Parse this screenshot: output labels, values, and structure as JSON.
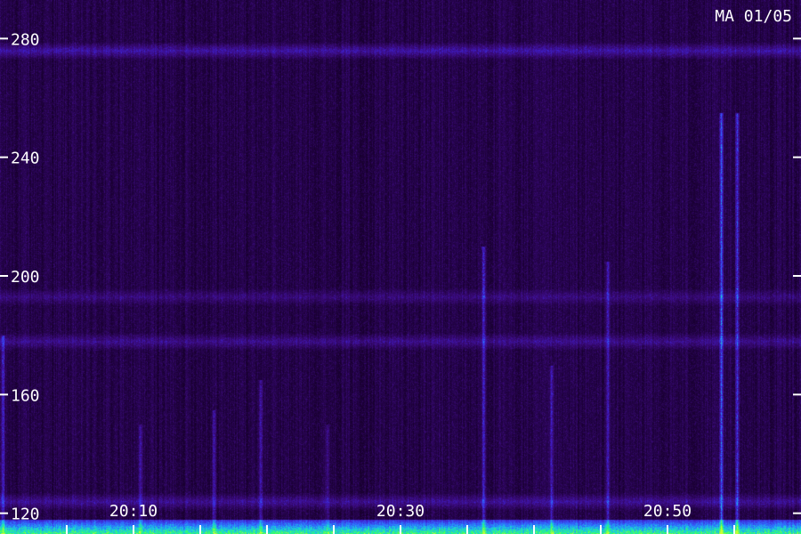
{
  "stamp": "MA 01/05",
  "chart_data": {
    "type": "heatmap",
    "title": "",
    "xlabel": "",
    "ylabel": "",
    "ylim": [
      113,
      293
    ],
    "y_ticks": [
      120,
      160,
      200,
      240,
      280
    ],
    "y_tick_labels": [
      "120",
      "160",
      "200",
      "240",
      "280"
    ],
    "xlim_minutes": [
      0,
      60
    ],
    "x_ticks": [
      "20:10",
      "20:30",
      "20:50"
    ],
    "x_tick_minutes": [
      10,
      30,
      50
    ],
    "x_minor_tick_minutes": [
      5,
      10,
      15,
      20,
      25,
      30,
      35,
      40,
      45,
      50,
      55
    ],
    "colormap": [
      "#000000",
      "#1a0033",
      "#3a0a7a",
      "#3f1fd0",
      "#2f6bff",
      "#19d0e0",
      "#33ff66",
      "#ccff33"
    ],
    "horizontal_bands": [
      {
        "y": 276,
        "strength": 0.6
      },
      {
        "y": 193,
        "strength": 0.35
      },
      {
        "y": 178,
        "strength": 0.45
      },
      {
        "y": 124,
        "strength": 0.5
      }
    ],
    "vertical_bursts": [
      {
        "minute": 0.2,
        "ymax": 180,
        "strength": 0.7
      },
      {
        "minute": 10.5,
        "ymax": 150,
        "strength": 0.5
      },
      {
        "minute": 16.0,
        "ymax": 155,
        "strength": 0.5
      },
      {
        "minute": 19.5,
        "ymax": 165,
        "strength": 0.6
      },
      {
        "minute": 24.5,
        "ymax": 150,
        "strength": 0.4
      },
      {
        "minute": 36.2,
        "ymax": 210,
        "strength": 0.7
      },
      {
        "minute": 41.3,
        "ymax": 170,
        "strength": 0.6
      },
      {
        "minute": 45.5,
        "ymax": 205,
        "strength": 0.6
      },
      {
        "minute": 54.0,
        "ymax": 255,
        "strength": 1.0
      },
      {
        "minute": 55.2,
        "ymax": 255,
        "strength": 0.9
      }
    ]
  }
}
